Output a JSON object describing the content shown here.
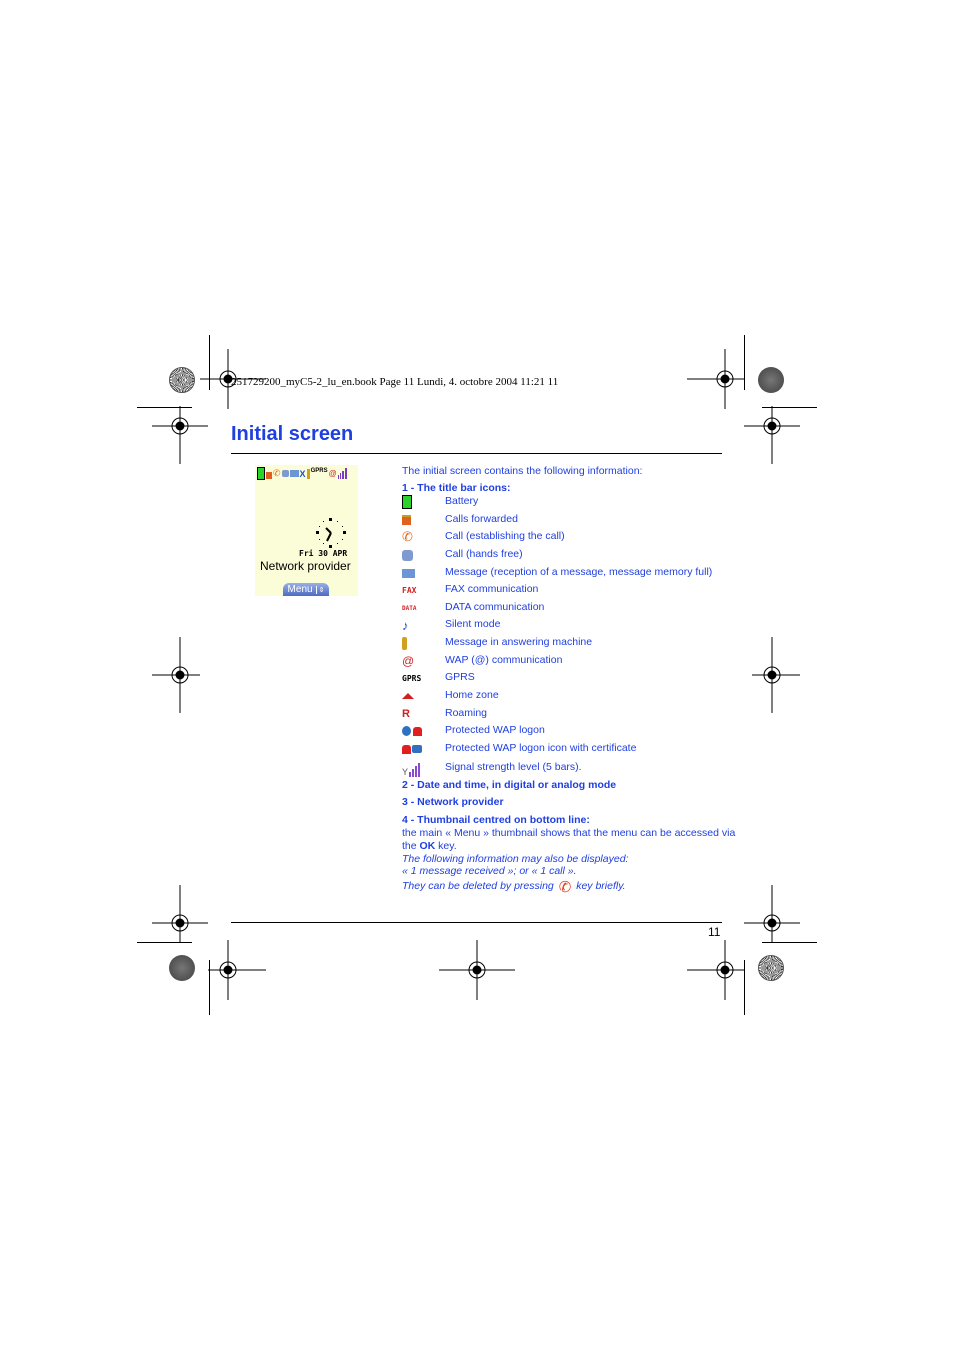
{
  "header_note": "251729200_myC5-2_lu_en.book  Page 11  Lundi, 4. octobre 2004  11:21 11",
  "page_title": "Initial screen",
  "page_number": "11",
  "colors": {
    "accent": "#1f3fe0",
    "phone_bg": "#fbfcd8"
  },
  "phone": {
    "status_icons": [
      "battery-icon",
      "calls-forwarded-icon",
      "call-establishing-icon",
      "hands-free-icon",
      "message-icon",
      "silent-icon",
      "answering-machine-icon",
      "gprs-icon",
      "home-zone-icon",
      "wap-icon",
      "signal-icon"
    ],
    "gprs_text": "GPRS",
    "date": "Fri 30 APR",
    "provider": "Network provider",
    "menu_label": "Menu"
  },
  "content": {
    "intro": "The initial screen contains the following information:",
    "section1_heading": "1 - The title bar icons:",
    "icons": [
      {
        "icon": "battery-icon",
        "label": "Battery"
      },
      {
        "icon": "calls-forwarded-icon",
        "label": "Calls forwarded"
      },
      {
        "icon": "call-establishing-icon",
        "label": "Call (establishing the call)"
      },
      {
        "icon": "hands-free-icon",
        "label": "Call (hands free)"
      },
      {
        "icon": "message-icon",
        "label": "Message (reception of a message, message memory full)"
      },
      {
        "icon": "fax-icon",
        "label": "FAX communication",
        "glyph": "FAX"
      },
      {
        "icon": "data-icon",
        "label": "DATA communication",
        "glyph": "DATA"
      },
      {
        "icon": "silent-mode-icon",
        "label": "Silent mode"
      },
      {
        "icon": "answering-machine-icon",
        "label": "Message in answering machine"
      },
      {
        "icon": "wap-icon",
        "label": "WAP (@) communication",
        "glyph": "@"
      },
      {
        "icon": "gprs-icon",
        "label": "GPRS",
        "glyph": "GPRS"
      },
      {
        "icon": "home-zone-icon",
        "label": "Home zone"
      },
      {
        "icon": "roaming-icon",
        "label": "Roaming",
        "glyph": "R"
      },
      {
        "icon": "protected-wap-icon",
        "label": "Protected WAP logon"
      },
      {
        "icon": "protected-wap-certificate-icon",
        "label": "Protected WAP logon icon with certificate"
      },
      {
        "icon": "signal-strength-icon",
        "label": "Signal strength level (5 bars)."
      }
    ],
    "section2_heading": "2 - Date and time, in digital or analog mode",
    "section3_heading": "3 - Network provider",
    "section4_heading": "4 - Thumbnail centred on bottom line:",
    "section4_line1": "the main « Menu » thumbnail shows that the menu can be accessed via",
    "section4_line2_pre": "the ",
    "section4_line2_key": "OK",
    "section4_line2_post": " key.",
    "italic_line1": "The following information may also be displayed:",
    "italic_line2": "« 1 message received »; or « 1 call ».",
    "italic_line3_pre": "They can be deleted by pressing",
    "italic_line3_post": "key briefly."
  }
}
